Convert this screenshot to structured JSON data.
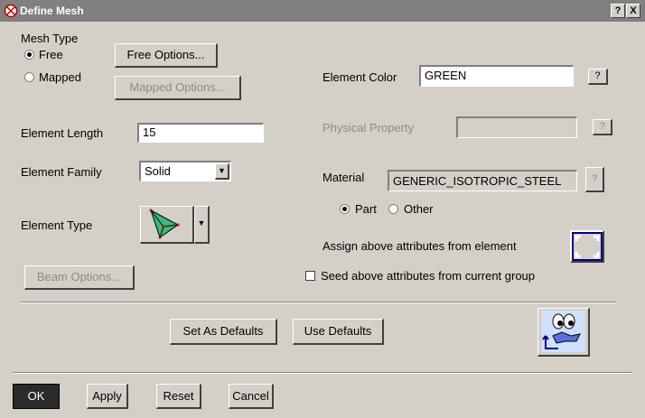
{
  "window": {
    "title": "Define Mesh",
    "help_label": "?",
    "close_label": "X"
  },
  "mesh_type": {
    "label": "Mesh Type",
    "free_label": "Free",
    "mapped_label": "Mapped",
    "selected": "Free",
    "free_options_label": "Free Options...",
    "mapped_options_label": "Mapped Options..."
  },
  "element_length": {
    "label": "Element Length",
    "value": "15"
  },
  "element_family": {
    "label": "Element Family",
    "value": "Solid"
  },
  "element_type": {
    "label": "Element Type",
    "icon": "tetrahedron-icon"
  },
  "beam_options_label": "Beam Options...",
  "element_color": {
    "label": "Element Color",
    "value": "GREEN",
    "help": "?"
  },
  "physical_property": {
    "label": "Physical Property",
    "value": "",
    "help": "?"
  },
  "material": {
    "label": "Material",
    "value": "GENERIC_ISOTROPIC_STEEL",
    "help": "?",
    "part_label": "Part",
    "other_label": "Other",
    "selected": "Part"
  },
  "assign_label": "Assign above attributes from element",
  "seed_label": "Seed above attributes from current group",
  "seed_checked": false,
  "defaults": {
    "set_label": "Set As Defaults",
    "use_label": "Use Defaults"
  },
  "footer": {
    "ok_label": "OK",
    "apply_label": "Apply",
    "reset_label": "Reset",
    "cancel_label": "Cancel"
  },
  "colors": {
    "dialog_bg": "#d4d0c8",
    "titlebar": "#808080",
    "assign_frame": "#0000a0"
  }
}
